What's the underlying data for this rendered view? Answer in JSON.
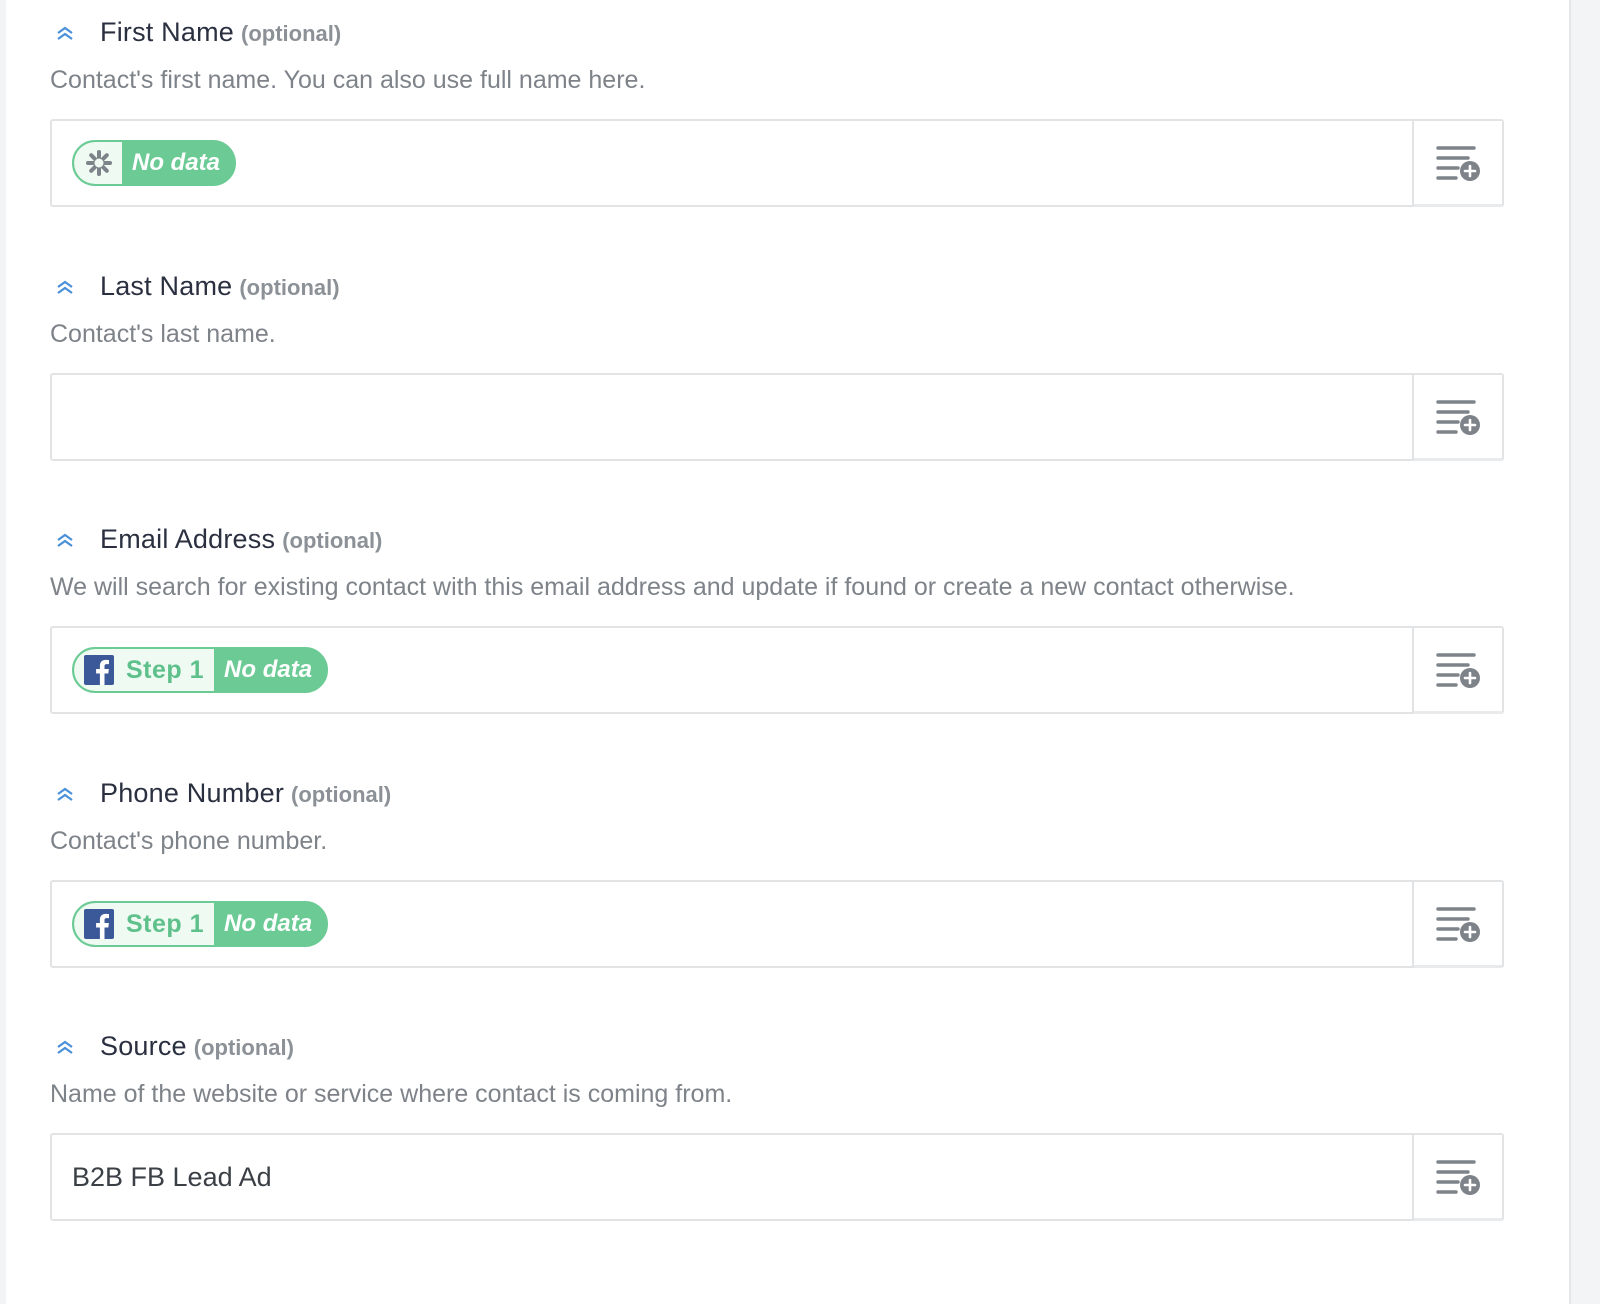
{
  "fields": [
    {
      "label": "First Name",
      "optional": "(optional)",
      "help": "Contact's first name. You can also use full name here.",
      "pill": {
        "icon": "zapier-asterisk-icon",
        "step": "",
        "status": "No data"
      },
      "value": ""
    },
    {
      "label": "Last Name",
      "optional": "(optional)",
      "help": "Contact's last name.",
      "pill": null,
      "value": ""
    },
    {
      "label": "Email Address",
      "optional": "(optional)",
      "help": "We will search for existing contact with this email address and update if found or create a new contact otherwise.",
      "pill": {
        "icon": "facebook-icon",
        "step": "Step 1",
        "status": "No data"
      },
      "value": ""
    },
    {
      "label": "Phone Number",
      "optional": "(optional)",
      "help": "Contact's phone number.",
      "pill": {
        "icon": "facebook-icon",
        "step": "Step 1",
        "status": "No data"
      },
      "value": ""
    },
    {
      "label": "Source",
      "optional": "(optional)",
      "help": "Name of the website or service where contact is coming from.",
      "pill": null,
      "value": "B2B FB Lead Ad"
    }
  ],
  "colors": {
    "pill_green": "#6ccb95",
    "facebook_blue": "#3b5998",
    "collapse_icon_blue": "#4a90d9",
    "insert_icon_gray": "#7d8389"
  },
  "icons": {
    "collapse": "double-chevron-up-icon",
    "insert_field": "list-add-icon"
  }
}
